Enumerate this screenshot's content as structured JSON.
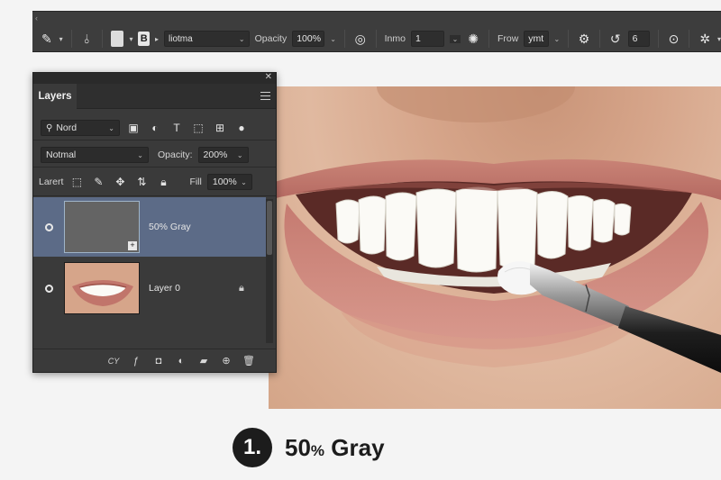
{
  "options_bar": {
    "brush_preset_label": "liotma",
    "mode_badge": "B",
    "opacity_label": "Opacity",
    "opacity_value": "100%",
    "flow_label": "Inmo",
    "flow_value": "1",
    "smoothing_label": "Frow",
    "smoothing_value": "ymt",
    "angle_value": "6"
  },
  "layers_panel": {
    "tab_label": "Layers",
    "filter_kind": "Nord",
    "blend_mode": "Notmal",
    "opacity_label": "Opacity:",
    "opacity_value": "200%",
    "lock_label": "Larert",
    "fill_label": "Fill",
    "fill_value": "100%",
    "layers": [
      {
        "name": "50% Gray",
        "selected": true
      },
      {
        "name": "Layer 0",
        "selected": false
      }
    ],
    "footer_link": "CY"
  },
  "caption": {
    "step_number": "1.",
    "text_main": "50",
    "text_small": "%",
    "text_tail": " Gray"
  },
  "colors": {
    "selection": "#5c6b87",
    "panel_bg": "#3a3a3a",
    "toolbar_bg": "#3d3d3d"
  }
}
